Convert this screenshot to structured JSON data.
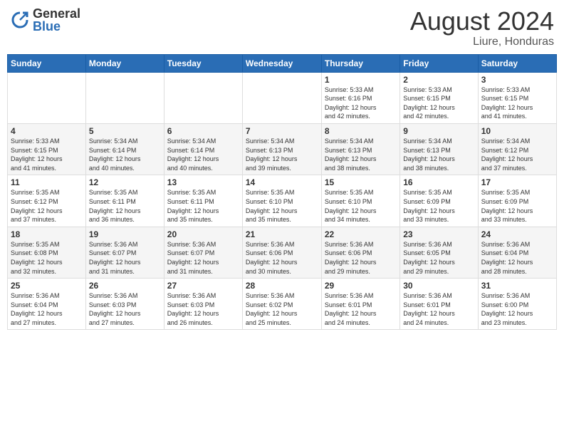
{
  "header": {
    "logo_general": "General",
    "logo_blue": "Blue",
    "month_year": "August 2024",
    "location": "Liure, Honduras"
  },
  "weekdays": [
    "Sunday",
    "Monday",
    "Tuesday",
    "Wednesday",
    "Thursday",
    "Friday",
    "Saturday"
  ],
  "weeks": [
    [
      {
        "day": "",
        "info": ""
      },
      {
        "day": "",
        "info": ""
      },
      {
        "day": "",
        "info": ""
      },
      {
        "day": "",
        "info": ""
      },
      {
        "day": "1",
        "info": "Sunrise: 5:33 AM\nSunset: 6:16 PM\nDaylight: 12 hours\nand 42 minutes."
      },
      {
        "day": "2",
        "info": "Sunrise: 5:33 AM\nSunset: 6:15 PM\nDaylight: 12 hours\nand 42 minutes."
      },
      {
        "day": "3",
        "info": "Sunrise: 5:33 AM\nSunset: 6:15 PM\nDaylight: 12 hours\nand 41 minutes."
      }
    ],
    [
      {
        "day": "4",
        "info": "Sunrise: 5:33 AM\nSunset: 6:15 PM\nDaylight: 12 hours\nand 41 minutes."
      },
      {
        "day": "5",
        "info": "Sunrise: 5:34 AM\nSunset: 6:14 PM\nDaylight: 12 hours\nand 40 minutes."
      },
      {
        "day": "6",
        "info": "Sunrise: 5:34 AM\nSunset: 6:14 PM\nDaylight: 12 hours\nand 40 minutes."
      },
      {
        "day": "7",
        "info": "Sunrise: 5:34 AM\nSunset: 6:13 PM\nDaylight: 12 hours\nand 39 minutes."
      },
      {
        "day": "8",
        "info": "Sunrise: 5:34 AM\nSunset: 6:13 PM\nDaylight: 12 hours\nand 38 minutes."
      },
      {
        "day": "9",
        "info": "Sunrise: 5:34 AM\nSunset: 6:13 PM\nDaylight: 12 hours\nand 38 minutes."
      },
      {
        "day": "10",
        "info": "Sunrise: 5:34 AM\nSunset: 6:12 PM\nDaylight: 12 hours\nand 37 minutes."
      }
    ],
    [
      {
        "day": "11",
        "info": "Sunrise: 5:35 AM\nSunset: 6:12 PM\nDaylight: 12 hours\nand 37 minutes."
      },
      {
        "day": "12",
        "info": "Sunrise: 5:35 AM\nSunset: 6:11 PM\nDaylight: 12 hours\nand 36 minutes."
      },
      {
        "day": "13",
        "info": "Sunrise: 5:35 AM\nSunset: 6:11 PM\nDaylight: 12 hours\nand 35 minutes."
      },
      {
        "day": "14",
        "info": "Sunrise: 5:35 AM\nSunset: 6:10 PM\nDaylight: 12 hours\nand 35 minutes."
      },
      {
        "day": "15",
        "info": "Sunrise: 5:35 AM\nSunset: 6:10 PM\nDaylight: 12 hours\nand 34 minutes."
      },
      {
        "day": "16",
        "info": "Sunrise: 5:35 AM\nSunset: 6:09 PM\nDaylight: 12 hours\nand 33 minutes."
      },
      {
        "day": "17",
        "info": "Sunrise: 5:35 AM\nSunset: 6:09 PM\nDaylight: 12 hours\nand 33 minutes."
      }
    ],
    [
      {
        "day": "18",
        "info": "Sunrise: 5:35 AM\nSunset: 6:08 PM\nDaylight: 12 hours\nand 32 minutes."
      },
      {
        "day": "19",
        "info": "Sunrise: 5:36 AM\nSunset: 6:07 PM\nDaylight: 12 hours\nand 31 minutes."
      },
      {
        "day": "20",
        "info": "Sunrise: 5:36 AM\nSunset: 6:07 PM\nDaylight: 12 hours\nand 31 minutes."
      },
      {
        "day": "21",
        "info": "Sunrise: 5:36 AM\nSunset: 6:06 PM\nDaylight: 12 hours\nand 30 minutes."
      },
      {
        "day": "22",
        "info": "Sunrise: 5:36 AM\nSunset: 6:06 PM\nDaylight: 12 hours\nand 29 minutes."
      },
      {
        "day": "23",
        "info": "Sunrise: 5:36 AM\nSunset: 6:05 PM\nDaylight: 12 hours\nand 29 minutes."
      },
      {
        "day": "24",
        "info": "Sunrise: 5:36 AM\nSunset: 6:04 PM\nDaylight: 12 hours\nand 28 minutes."
      }
    ],
    [
      {
        "day": "25",
        "info": "Sunrise: 5:36 AM\nSunset: 6:04 PM\nDaylight: 12 hours\nand 27 minutes."
      },
      {
        "day": "26",
        "info": "Sunrise: 5:36 AM\nSunset: 6:03 PM\nDaylight: 12 hours\nand 27 minutes."
      },
      {
        "day": "27",
        "info": "Sunrise: 5:36 AM\nSunset: 6:03 PM\nDaylight: 12 hours\nand 26 minutes."
      },
      {
        "day": "28",
        "info": "Sunrise: 5:36 AM\nSunset: 6:02 PM\nDaylight: 12 hours\nand 25 minutes."
      },
      {
        "day": "29",
        "info": "Sunrise: 5:36 AM\nSunset: 6:01 PM\nDaylight: 12 hours\nand 24 minutes."
      },
      {
        "day": "30",
        "info": "Sunrise: 5:36 AM\nSunset: 6:01 PM\nDaylight: 12 hours\nand 24 minutes."
      },
      {
        "day": "31",
        "info": "Sunrise: 5:36 AM\nSunset: 6:00 PM\nDaylight: 12 hours\nand 23 minutes."
      }
    ]
  ]
}
